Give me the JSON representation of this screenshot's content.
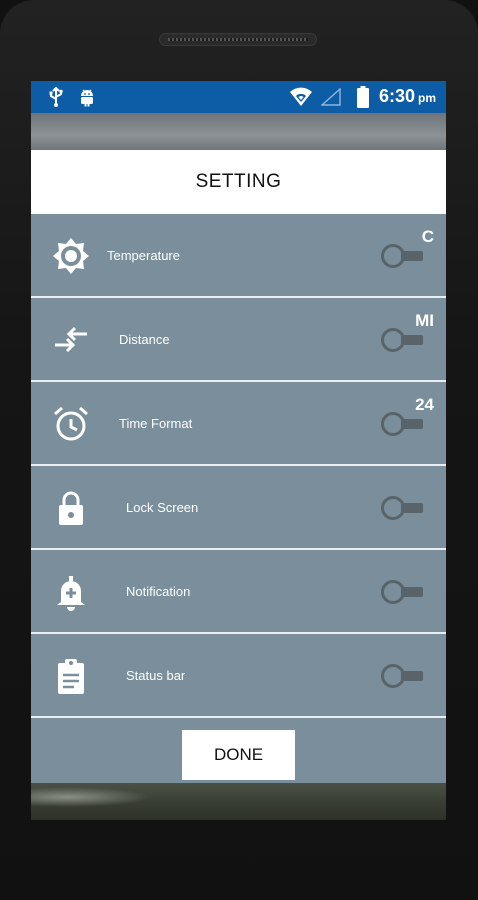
{
  "status_bar": {
    "time": "6:30",
    "ampm": "pm",
    "icons": [
      "usb-icon",
      "android-debug-icon",
      "wifi-icon",
      "signal-icon",
      "battery-icon"
    ],
    "color": "#0d5da6"
  },
  "dialog": {
    "title": "SETTING",
    "done_label": "DONE",
    "row_background": "#7a8f9b"
  },
  "settings": [
    {
      "label": "Temperature",
      "value": "C",
      "icon": "brightness-gear-icon"
    },
    {
      "label": "Distance",
      "value": "MI",
      "icon": "swap-arrows-icon"
    },
    {
      "label": "Time Format",
      "value": "24",
      "icon": "alarm-clock-icon"
    },
    {
      "label": "Lock Screen",
      "value": "",
      "icon": "lock-icon"
    },
    {
      "label": "Notification",
      "value": "",
      "icon": "bell-plus-icon"
    },
    {
      "label": "Status bar",
      "value": "",
      "icon": "clipboard-icon"
    }
  ]
}
